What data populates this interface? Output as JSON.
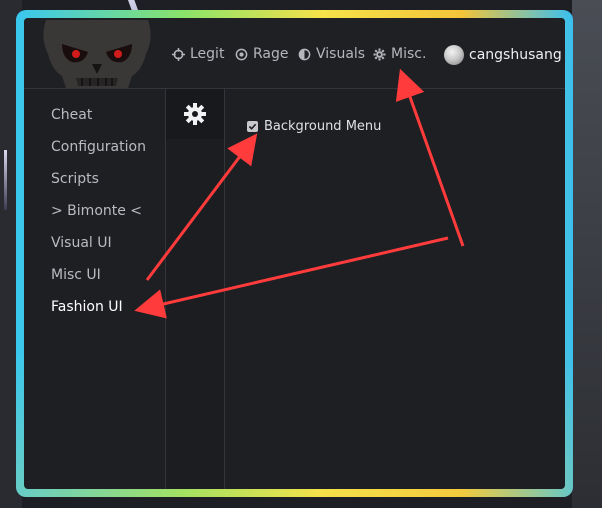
{
  "tabs": [
    {
      "label": "Legit",
      "icon": "crosshair-icon"
    },
    {
      "label": "Rage",
      "icon": "target-icon"
    },
    {
      "label": "Visuals",
      "icon": "half-circle-icon"
    },
    {
      "label": "Misc.",
      "icon": "gear-icon"
    }
  ],
  "user": {
    "name": "cangshusang"
  },
  "sidebar": {
    "items": [
      {
        "label": "Cheat"
      },
      {
        "label": "Configuration"
      },
      {
        "label": "Scripts"
      },
      {
        "label": "> Bimonte <"
      },
      {
        "label": "Visual UI"
      },
      {
        "label": "Misc UI"
      },
      {
        "label": "Fashion UI"
      }
    ],
    "active_index": 6
  },
  "content": {
    "checkbox_label": "Background Menu",
    "checked": true
  },
  "colors": {
    "accent": "#ff3b3b",
    "panel": "#1e1f23",
    "frame_gradient": [
      "#39c7f0",
      "#8ae36a",
      "#f6e24a",
      "#39c0f0"
    ]
  }
}
